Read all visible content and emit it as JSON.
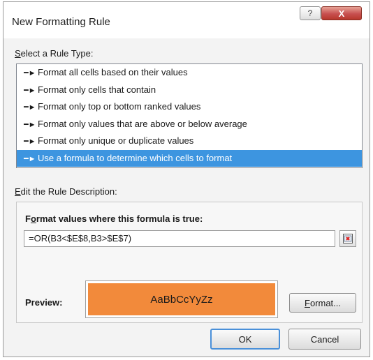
{
  "dialog": {
    "title": "New Formatting Rule",
    "help_glyph": "?",
    "close_glyph": "X"
  },
  "rule_type": {
    "label_hotkey": "S",
    "label_rest": "elect a Rule Type:",
    "items": [
      {
        "label": "Format all cells based on their values",
        "selected": false
      },
      {
        "label": "Format only cells that contain",
        "selected": false
      },
      {
        "label": "Format only top or bottom ranked values",
        "selected": false
      },
      {
        "label": "Format only values that are above or below average",
        "selected": false
      },
      {
        "label": "Format only unique or duplicate values",
        "selected": false
      },
      {
        "label": "Use a formula to determine which cells to format",
        "selected": true
      }
    ]
  },
  "description": {
    "label_hotkey": "E",
    "label_rest": "dit the Rule Description:",
    "formula_label_hotkey": "o",
    "formula_label_pre": "F",
    "formula_label_rest": "rmat values where this formula is true:",
    "formula_value": "=OR(B3<$E$8,B3>$E$7)",
    "preview_label": "Preview:",
    "preview_text": "AaBbCcYyZz",
    "preview_fill_color": "#f28a3b",
    "format_button_hotkey": "F",
    "format_button_rest": "ormat..."
  },
  "buttons": {
    "ok": "OK",
    "cancel": "Cancel"
  },
  "icons": {
    "list_bullet": "arrow-right-icon",
    "collapse": "collapse-dialog-icon"
  }
}
